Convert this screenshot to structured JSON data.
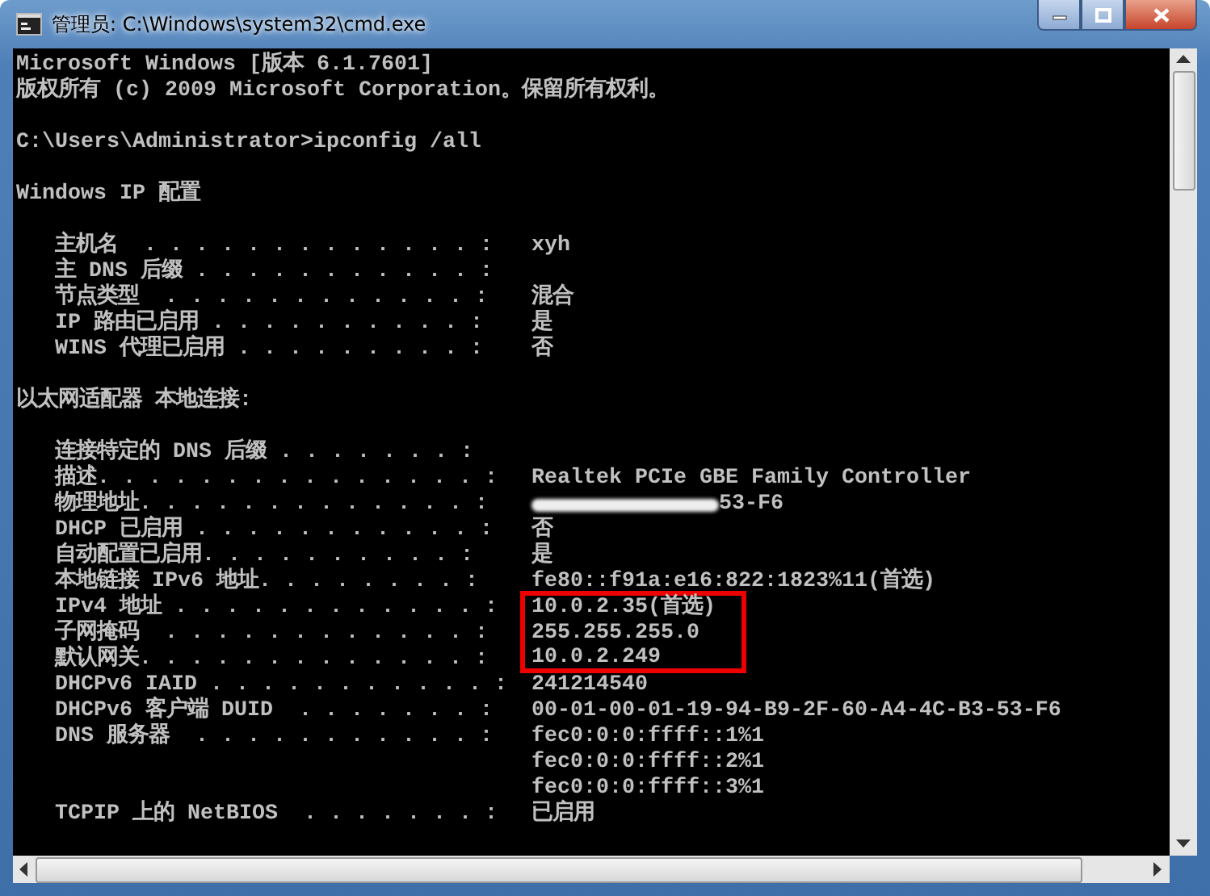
{
  "window": {
    "title": "管理员: C:\\Windows\\system32\\cmd.exe"
  },
  "console": {
    "header": [
      {
        "kind": "line",
        "text": "Microsoft Windows [版本 6.1.7601]"
      },
      {
        "kind": "line",
        "text": "版权所有 (c) 2009 Microsoft Corporation。保留所有权利。"
      },
      {
        "kind": "blank"
      },
      {
        "kind": "line",
        "text": "C:\\Users\\Administrator>ipconfig /all"
      },
      {
        "kind": "blank"
      },
      {
        "kind": "line",
        "text": "Windows IP 配置"
      }
    ],
    "sections": [
      {
        "rows": [
          {
            "label": "主机名  . . . . . . . . . . . . . :",
            "value": "xyh",
            "highlighted": false,
            "redacted": false
          },
          {
            "label": "主 DNS 后缀 . . . . . . . . . . . :",
            "highlighted": false,
            "redacted": false
          },
          {
            "label": "节点类型  . . . . . . . . . . . . :",
            "value": "混合",
            "highlighted": false,
            "redacted": false
          },
          {
            "label": "IP 路由已启用 . . . . . . . . . . :",
            "value": "是",
            "highlighted": false,
            "redacted": false
          },
          {
            "label": "WINS 代理已启用 . . . . . . . . . :",
            "value": "否",
            "highlighted": false,
            "redacted": false
          }
        ]
      },
      {
        "title": "以太网适配器 本地连接:",
        "rows": [
          {
            "label": "连接特定的 DNS 后缀 . . . . . . . :",
            "highlighted": false,
            "redacted": false
          },
          {
            "label": "描述. . . . . . . . . . . . . . . :",
            "value": "Realtek PCIe GBE Family Controller",
            "highlighted": false,
            "redacted": false
          },
          {
            "label": "物理地址. . . . . . . . . . . . . :",
            "value": "53-F6",
            "highlighted": false,
            "redacted": true
          },
          {
            "label": "DHCP 已启用 . . . . . . . . . . . :",
            "value": "否",
            "highlighted": false,
            "redacted": false
          },
          {
            "label": "自动配置已启用. . . . . . . . . . :",
            "value": "是",
            "highlighted": false,
            "redacted": false
          },
          {
            "label": "本地链接 IPv6 地址. . . . . . . . :",
            "value": "fe80::f91a:e16:822:1823%11(首选)",
            "highlighted": false,
            "redacted": false
          },
          {
            "label": "IPv4 地址 . . . . . . . . . . . . :",
            "value": "10.0.2.35(首选)",
            "highlighted": true,
            "redacted": false
          },
          {
            "label": "子网掩码  . . . . . . . . . . . . :",
            "value": "255.255.255.0",
            "highlighted": true,
            "redacted": false
          },
          {
            "label": "默认网关. . . . . . . . . . . . . :",
            "value": "10.0.2.249",
            "highlighted": true,
            "redacted": false
          },
          {
            "label": "DHCPv6 IAID . . . . . . . . . . . :",
            "value": "241214540",
            "highlighted": false,
            "redacted": false
          },
          {
            "label": "DHCPv6 客户端 DUID  . . . . . . . :",
            "value": "00-01-00-01-19-94-B9-2F-60-A4-4C-B3-53-F6",
            "highlighted": false,
            "redacted": false
          },
          {
            "label": "DNS 服务器  . . . . . . . . . . . :",
            "value": "fec0:0:0:ffff::1%1",
            "highlighted": false,
            "redacted": false
          },
          {
            "value": "fec0:0:0:ffff::2%1",
            "highlighted": false,
            "redacted": false
          },
          {
            "value": "fec0:0:0:ffff::3%1",
            "highlighted": false,
            "redacted": false
          },
          {
            "label": "TCPIP 上的 NetBIOS  . . . . . . . :",
            "value": "已启用",
            "highlighted": false,
            "redacted": false
          }
        ]
      }
    ]
  }
}
